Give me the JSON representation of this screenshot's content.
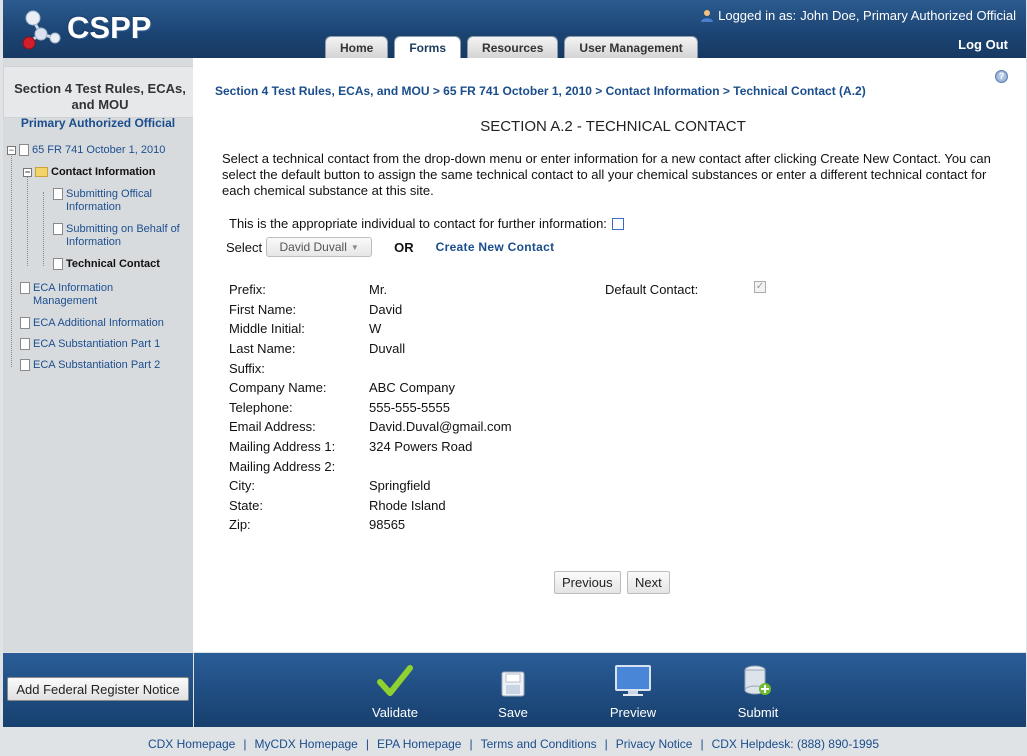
{
  "header": {
    "logo_text": "CSPP",
    "logged_in_label": "Logged in as:",
    "logged_in_user": "John Doe, Primary Authorized Official",
    "logout": "Log Out",
    "tabs": [
      {
        "label": "Home"
      },
      {
        "label": "Forms"
      },
      {
        "label": "Resources"
      },
      {
        "label": "User Management"
      }
    ]
  },
  "sidebar": {
    "title": "Section 4 Test Rules, ECAs, and MOU",
    "role": "Primary Authorized Official",
    "tree": [
      {
        "label": "65 FR 741 October 1, 2010"
      },
      {
        "label": "Contact Information"
      },
      {
        "label": "Submitting Offical Information"
      },
      {
        "label": "Submitting on Behalf of Information"
      },
      {
        "label": "Technical Contact"
      },
      {
        "label": "ECA Information Management"
      },
      {
        "label": "ECA Additional Information"
      },
      {
        "label": "ECA Substantiation Part 1"
      },
      {
        "label": "ECA Substantiation Part 2"
      }
    ]
  },
  "main": {
    "breadcrumb": "Section 4 Test Rules, ECAs, and MOU > 65 FR 741 October 1, 2010 > Contact Information > Technical Contact (A.2)",
    "section_title": "SECTION A.2 - TECHNICAL CONTACT",
    "instructions": "Select a technical contact from the drop-down menu or enter information for a new contact after clicking Create New Contact. You can select the default button to assign the same technical contact to all your chemical substances or enter a different technical contact for each chemical substance at this site.",
    "appropriate_label": "This is the appropriate individual to contact for further information:",
    "select_label": "Select",
    "select_value": "David Duvall",
    "or_label": "OR",
    "create_new": "Create New Contact",
    "default_contact_label": "Default Contact:",
    "fields": [
      {
        "label": "Prefix:",
        "value": "Mr."
      },
      {
        "label": "First Name:",
        "value": "David"
      },
      {
        "label": "Middle Initial:",
        "value": "W"
      },
      {
        "label": "Last Name:",
        "value": "Duvall"
      },
      {
        "label": "Suffix:",
        "value": ""
      },
      {
        "label": "Company Name:",
        "value": "ABC Company"
      },
      {
        "label": "Telephone:",
        "value": "555-555-5555"
      },
      {
        "label": "Email Address:",
        "value": "David.Duval@gmail.com"
      },
      {
        "label": "Mailing Address 1:",
        "value": "324 Powers Road"
      },
      {
        "label": "Mailing Address 2:",
        "value": ""
      },
      {
        "label": "City:",
        "value": "Springfield"
      },
      {
        "label": "State:",
        "value": "Rhode Island"
      },
      {
        "label": "Zip:",
        "value": "98565"
      }
    ],
    "previous": "Previous",
    "next": "Next"
  },
  "bottom": {
    "add_notice": "Add Federal Register Notice",
    "actions": [
      {
        "label": "Validate",
        "icon": "checkmark-icon"
      },
      {
        "label": "Save",
        "icon": "save-icon"
      },
      {
        "label": "Preview",
        "icon": "monitor-icon"
      },
      {
        "label": "Submit",
        "icon": "database-add-icon"
      }
    ]
  },
  "footer": {
    "links": [
      "CDX Homepage",
      "MyCDX Homepage",
      "EPA Homepage",
      "Terms and Conditions",
      "Privacy Notice",
      "CDX Helpdesk: (888) 890-1995"
    ]
  }
}
